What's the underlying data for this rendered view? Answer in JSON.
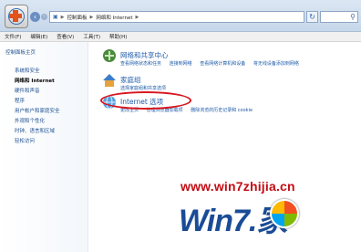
{
  "address": {
    "segments": [
      "控制面板",
      "网络和 Internet"
    ],
    "separator": "▶"
  },
  "menubar": [
    "文件(F)",
    "编辑(E)",
    "查看(V)",
    "工具(T)",
    "帮助(H)"
  ],
  "sidebar": {
    "home": "控制面板主页",
    "items": [
      {
        "label": "系统和安全",
        "active": false
      },
      {
        "label": "网络和 Internet",
        "active": true
      },
      {
        "label": "硬件和声音",
        "active": false
      },
      {
        "label": "程序",
        "active": false
      },
      {
        "label": "用户帐户和家庭安全",
        "active": false
      },
      {
        "label": "外观和个性化",
        "active": false
      },
      {
        "label": "时钟、语言和区域",
        "active": false
      },
      {
        "label": "轻松访问",
        "active": false
      }
    ]
  },
  "categories": [
    {
      "title": "网络和共享中心",
      "links": [
        "查看网络状态和任务",
        "连接到网络",
        "查看网络计算机和设备",
        "将无线设备添加到网络"
      ]
    },
    {
      "title": "家庭组",
      "links": [
        "选择家庭组和共享选项"
      ]
    },
    {
      "title": "Internet 选项",
      "links": [
        "更改主页",
        "管理浏览器加载项",
        "删除浏览的历史记录和 cookie"
      ]
    }
  ],
  "watermark": {
    "url": "www.win7zhijia.cn",
    "logo": "Win7.家"
  },
  "colors": {
    "accent": "#1e5aa8",
    "highlight_circle": "#d8151d",
    "watermark_red": "#c40a12"
  }
}
